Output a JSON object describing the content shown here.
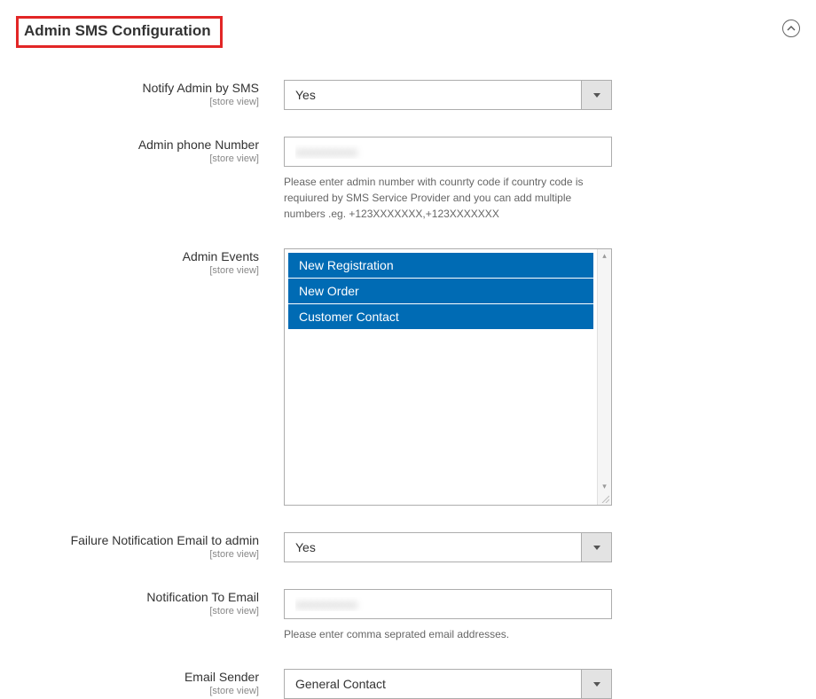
{
  "section": {
    "title": "Admin SMS Configuration"
  },
  "scope": "[store view]",
  "fields": {
    "notify_admin": {
      "label": "Notify Admin by SMS",
      "value": "Yes"
    },
    "admin_phone": {
      "label": "Admin phone Number",
      "value": "xxxxxxxxxx",
      "hint": "Please enter admin number with counrty code if country code is requiured by SMS Service Provider and you can add multiple numbers .eg. +123XXXXXXX,+123XXXXXXX"
    },
    "admin_events": {
      "label": "Admin Events",
      "options": [
        "New Registration",
        "New Order",
        "Customer Contact"
      ]
    },
    "failure_email": {
      "label": "Failure Notification Email to admin",
      "value": "Yes"
    },
    "notify_email": {
      "label": "Notification To Email",
      "value": "xxxxxxxxxx",
      "hint": "Please enter comma seprated email addresses."
    },
    "email_sender": {
      "label": "Email Sender",
      "value": "General Contact"
    }
  }
}
